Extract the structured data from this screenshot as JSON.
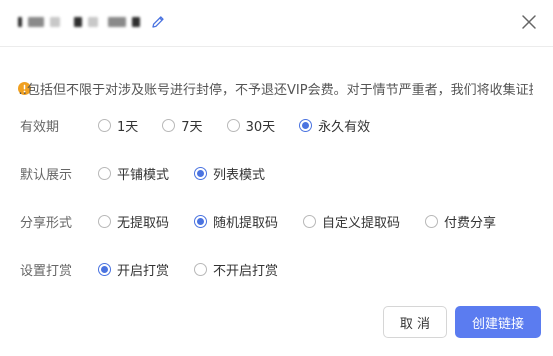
{
  "dialog": {
    "notice": "…包括但不限于对涉及账号进行封停，不予退还VIP会费。对于情节严重者，我们将收集证据并提交相关部门处理。"
  },
  "validity": {
    "label": "有效期",
    "options": [
      "1天",
      "7天",
      "30天",
      "永久有效"
    ],
    "selected": "永久有效"
  },
  "display": {
    "label": "默认展示",
    "options": [
      "平铺模式",
      "列表模式"
    ],
    "selected": "列表模式"
  },
  "share": {
    "label": "分享形式",
    "options": [
      "无提取码",
      "随机提取码",
      "自定义提取码",
      "付费分享"
    ],
    "selected": "随机提取码"
  },
  "tip": {
    "label": "设置打赏",
    "options": [
      "开启打赏",
      "不开启打赏"
    ],
    "selected": "开启打赏"
  },
  "footer": {
    "cancel_label": "取 消",
    "create_label": "创建链接"
  },
  "colors": {
    "accent": "#4a73e0",
    "primary_button": "#5b7cf0",
    "warning": "#f0a020"
  }
}
